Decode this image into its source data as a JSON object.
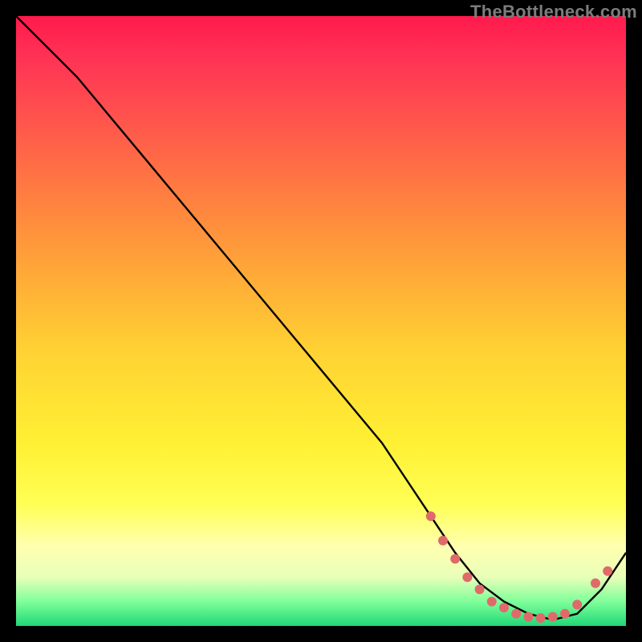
{
  "watermark": "TheBottleneck.com",
  "chart_data": {
    "type": "line",
    "title": "",
    "xlabel": "",
    "ylabel": "",
    "xlim": [
      0,
      100
    ],
    "ylim": [
      0,
      100
    ],
    "grid": false,
    "legend": false,
    "background_gradient": {
      "top": "#ff1a4d",
      "middle": "#ffff55",
      "bottom": "#1fd877"
    },
    "series": [
      {
        "name": "bottleneck-curve",
        "color": "#000000",
        "x": [
          0,
          5,
          10,
          20,
          30,
          40,
          50,
          60,
          68,
          72,
          76,
          80,
          84,
          88,
          92,
          96,
          100
        ],
        "y": [
          100,
          95,
          90,
          78,
          66,
          54,
          42,
          30,
          18,
          12,
          7,
          4,
          2,
          1,
          2,
          6,
          12
        ]
      }
    ],
    "markers": [
      {
        "name": "highlight-dots",
        "color": "#e06a6a",
        "radius": 6,
        "points": [
          {
            "x": 68,
            "y": 18
          },
          {
            "x": 70,
            "y": 14
          },
          {
            "x": 72,
            "y": 11
          },
          {
            "x": 74,
            "y": 8
          },
          {
            "x": 76,
            "y": 6
          },
          {
            "x": 78,
            "y": 4
          },
          {
            "x": 80,
            "y": 3
          },
          {
            "x": 82,
            "y": 2
          },
          {
            "x": 84,
            "y": 1.5
          },
          {
            "x": 86,
            "y": 1.3
          },
          {
            "x": 88,
            "y": 1.5
          },
          {
            "x": 90,
            "y": 2
          },
          {
            "x": 92,
            "y": 3.5
          },
          {
            "x": 95,
            "y": 7
          },
          {
            "x": 97,
            "y": 9
          }
        ]
      }
    ]
  }
}
